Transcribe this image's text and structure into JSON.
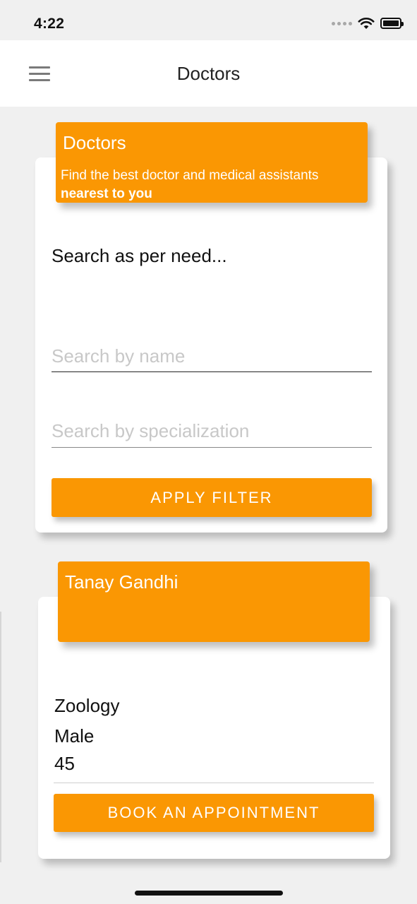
{
  "status_bar": {
    "time": "4:22"
  },
  "header": {
    "title": "Doctors",
    "menu_icon": "hamburger-menu-icon"
  },
  "filter_card": {
    "banner_title": "Doctors",
    "banner_subtitle": "Find the best doctor and medical assistants",
    "banner_subtitle_bold": "nearest to you",
    "heading": "Search as per need...",
    "name_field": {
      "placeholder": "Search by name",
      "value": ""
    },
    "specialization_field": {
      "placeholder": "Search by specialization",
      "value": ""
    },
    "apply_button": "APPLY FILTER"
  },
  "doctors": [
    {
      "name": "Tanay Gandhi",
      "specialization": "Zoology",
      "gender": "Male",
      "age": "45",
      "book_button": "BOOK AN APPOINTMENT"
    }
  ],
  "colors": {
    "accent": "#fa9703",
    "background": "#f0f0f0",
    "card": "#ffffff"
  }
}
